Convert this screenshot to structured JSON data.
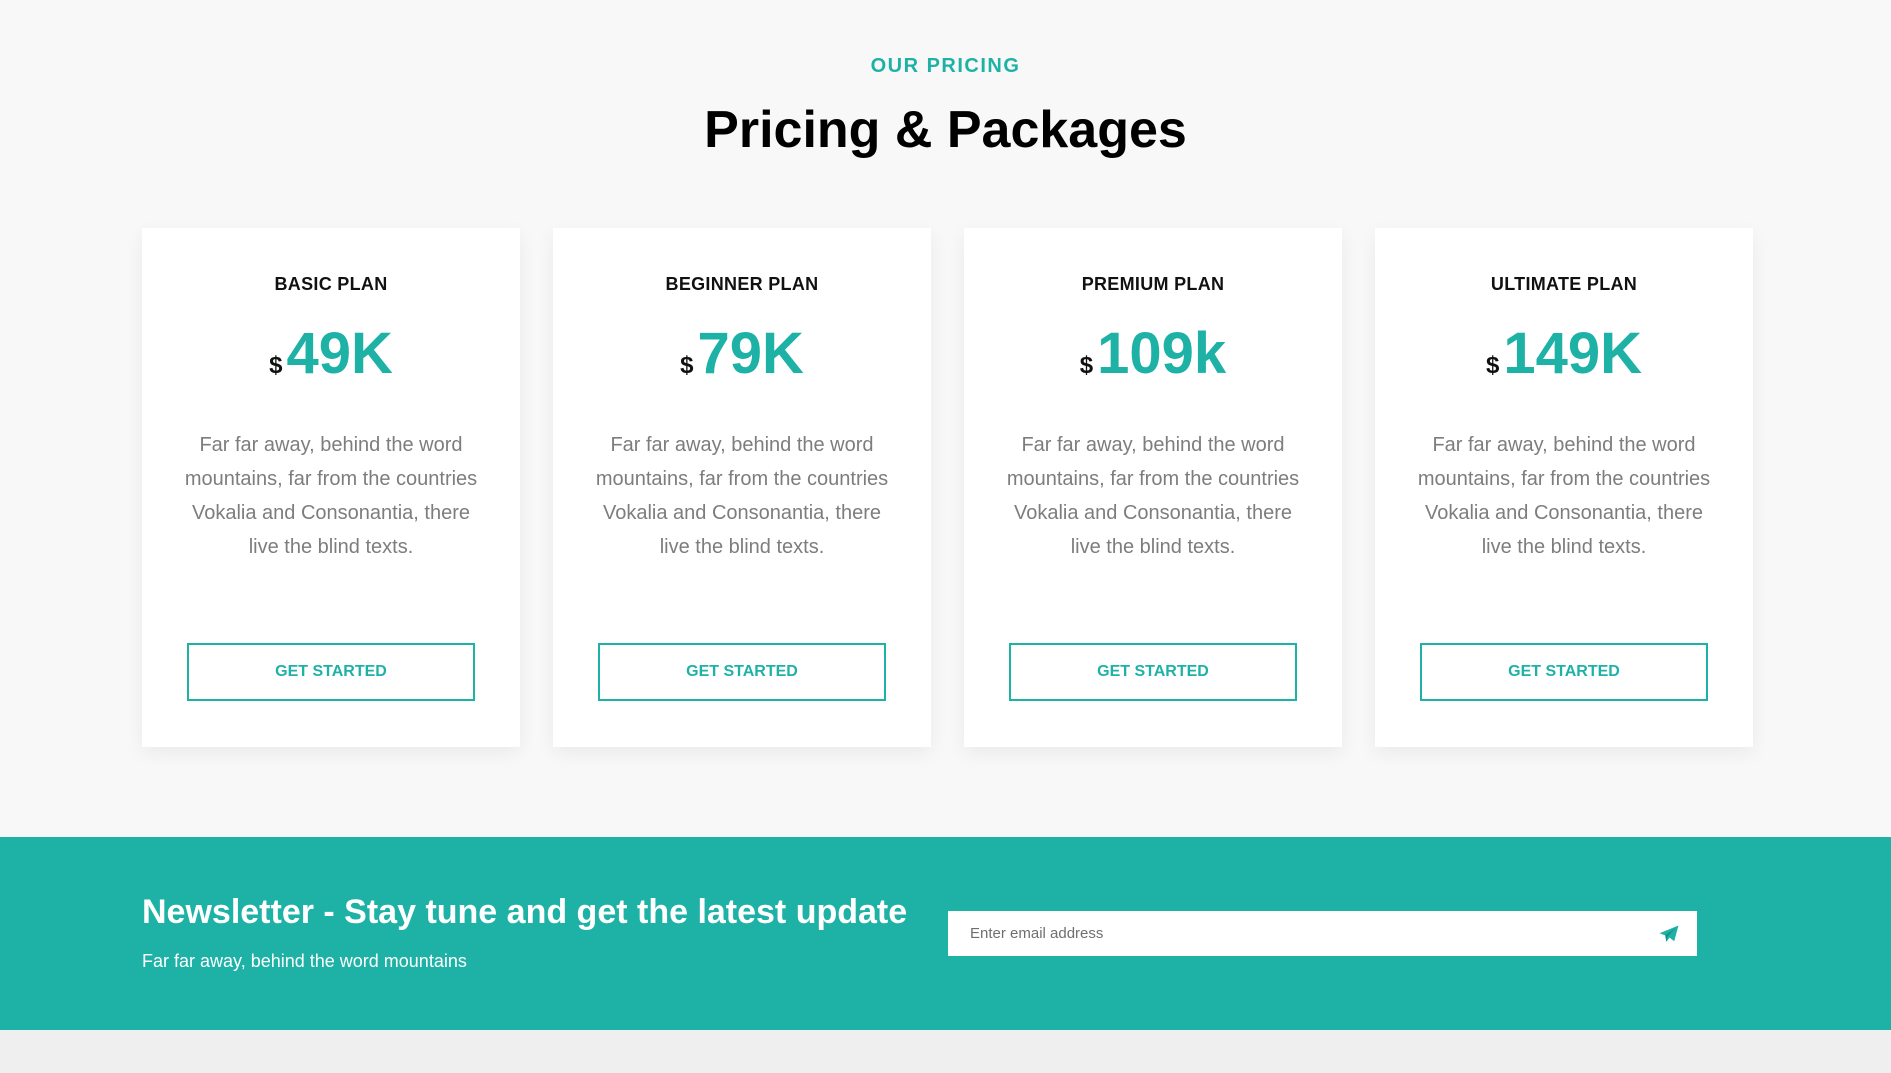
{
  "section": {
    "eyebrow": "OUR PRICING",
    "title": "Pricing & Packages"
  },
  "plans": [
    {
      "name": "BASIC PLAN",
      "currency": "$",
      "price": "49K",
      "description": "Far far away, behind the word mountains, far from the countries Vokalia and Consonantia, there live the blind texts.",
      "cta": "GET STARTED"
    },
    {
      "name": "BEGINNER PLAN",
      "currency": "$",
      "price": "79K",
      "description": "Far far away, behind the word mountains, far from the countries Vokalia and Consonantia, there live the blind texts.",
      "cta": "GET STARTED"
    },
    {
      "name": "PREMIUM PLAN",
      "currency": "$",
      "price": "109k",
      "description": "Far far away, behind the word mountains, far from the countries Vokalia and Consonantia, there live the blind texts.",
      "cta": "GET STARTED"
    },
    {
      "name": "ULTIMATE PLAN",
      "currency": "$",
      "price": "149K",
      "description": "Far far away, behind the word mountains, far from the countries Vokalia and Consonantia, there live the blind texts.",
      "cta": "GET STARTED"
    }
  ],
  "newsletter": {
    "title": "Newsletter - Stay tune and get the latest update",
    "subtitle": "Far far away, behind the word mountains",
    "placeholder": "Enter email address",
    "submit_icon": "paper-plane-icon"
  },
  "colors": {
    "accent": "#1eb2a6",
    "background": "#f8f8f8",
    "card": "#ffffff",
    "body_text": "#7d7d7d"
  }
}
